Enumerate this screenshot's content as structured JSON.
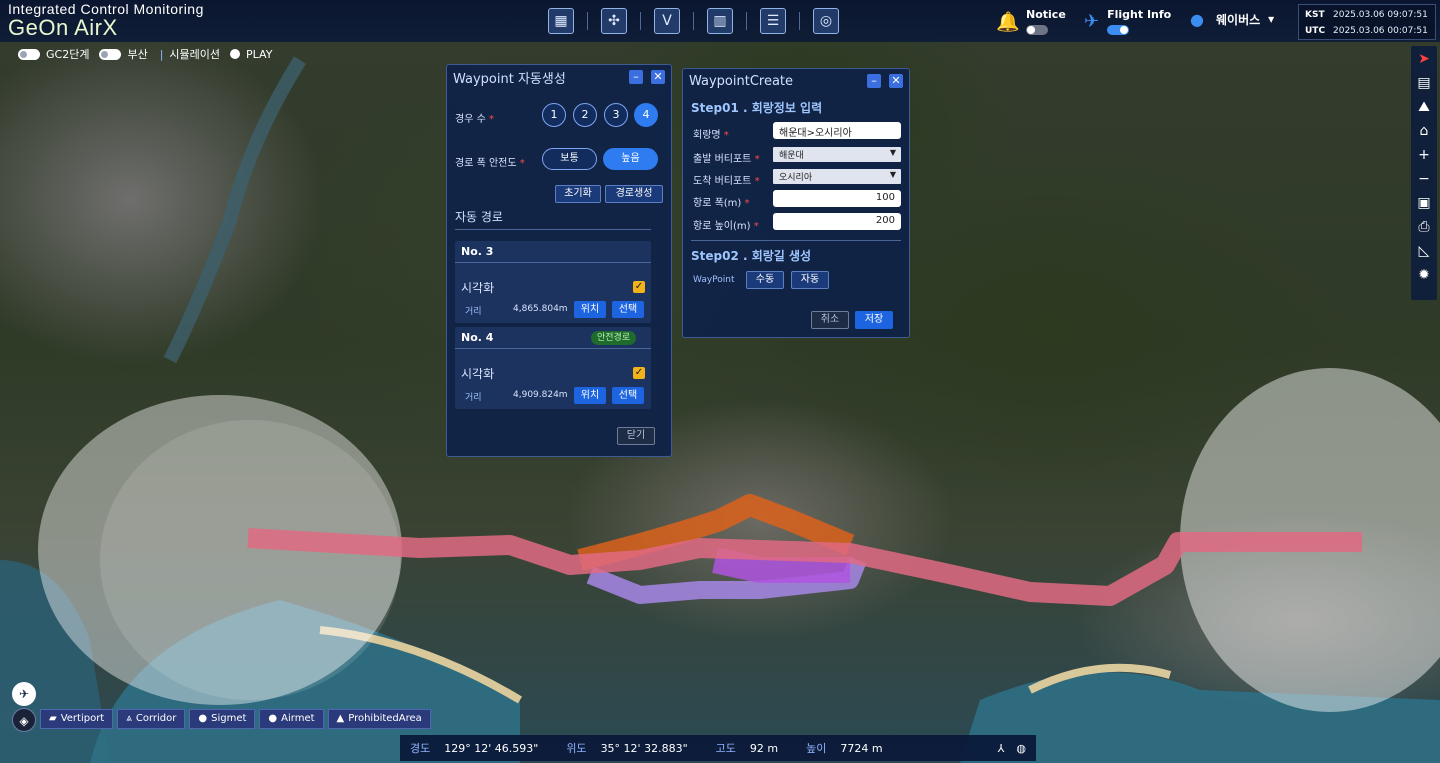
{
  "header": {
    "subtitle_parts": [
      "I",
      "ntegrated ",
      "C",
      "ontrol ",
      "M",
      "onitoring"
    ],
    "logo_text": "GeOn AirX",
    "nav_icons": [
      "map-grid-icon",
      "drone-icon",
      "vertiport-icon",
      "corridor-icon",
      "dashboard-icon",
      "globe-settings-icon"
    ],
    "notice_label": "Notice",
    "flight_info_label": "Flight Info",
    "user_name": "웨이버스",
    "clock": {
      "kst_label": "KST",
      "kst_value": "2025.03.06 09:07:51",
      "utc_label": "UTC",
      "utc_value": "2025.03.06 00:07:51"
    }
  },
  "subbar": {
    "toggle1_label": "GC2단계",
    "toggle2_label": "부산",
    "sim_label": "시뮬레이션",
    "play_label": "PLAY"
  },
  "waypoint_panel": {
    "title": "Waypoint 자동생성",
    "case_label": "경우 수",
    "case_options": [
      "1",
      "2",
      "3",
      "4"
    ],
    "case_selected": "4",
    "width_label": "경로 폭 안전도",
    "width_options": [
      "보통",
      "높음"
    ],
    "width_selected": "높음",
    "reset_label": "초기화",
    "generate_label": "경로생성",
    "auto_route_label": "자동 경로",
    "routes": [
      {
        "no": "No. 3",
        "visual_label": "시각화",
        "distance_label": "거리",
        "distance": "4,865.804m",
        "loc_label": "위치",
        "select_label": "선택",
        "badge": ""
      },
      {
        "no": "No. 4",
        "visual_label": "시각화",
        "distance_label": "거리",
        "distance": "4,909.824m",
        "loc_label": "위치",
        "select_label": "선택",
        "badge": "안전경로"
      }
    ],
    "close_label": "닫기"
  },
  "waypoint_create": {
    "title": "WaypointCreate",
    "step1": "Step01 . 회랑정보 입력",
    "corridor_name_label": "회랑명",
    "corridor_name_value": "해운대>오시리아",
    "dep_label": "출발 버티포트",
    "dep_value": "해운대",
    "arr_label": "도착 버티포트",
    "arr_value": "오시리아",
    "width_label": "항로 폭(m)",
    "width_value": "100",
    "height_label": "항로 높이(m)",
    "height_value": "200",
    "step2": "Step02 . 회랑길 생성",
    "waypoint_label": "WayPoint",
    "manual_label": "수동",
    "auto_label": "자동",
    "cancel_label": "취소",
    "save_label": "저장"
  },
  "right_tools": [
    "compass-icon",
    "map-layers-icon",
    "terrain-icon",
    "home-icon",
    "zoom-in-icon",
    "zoom-out-icon",
    "capture-icon",
    "print-icon",
    "measure-icon",
    "settings-icon"
  ],
  "layers": [
    "Vertiport",
    "Corridor",
    "Sigmet",
    "Airmet",
    "ProhibitedArea"
  ],
  "coords": {
    "lon_label": "경도",
    "lon_value": "129° 12' 46.593\"",
    "lat_label": "위도",
    "lat_value": "35° 12' 32.883\"",
    "alt_label": "고도",
    "alt_value": "92 m",
    "height_label": "높이",
    "height_value": "7724 m"
  },
  "colors": {
    "corridor_main": "#e06a82",
    "route_orange": "#e0621a",
    "route_purple": "#b055e0",
    "route_lavender": "#a787e6",
    "accent": "#2f7cf0"
  }
}
